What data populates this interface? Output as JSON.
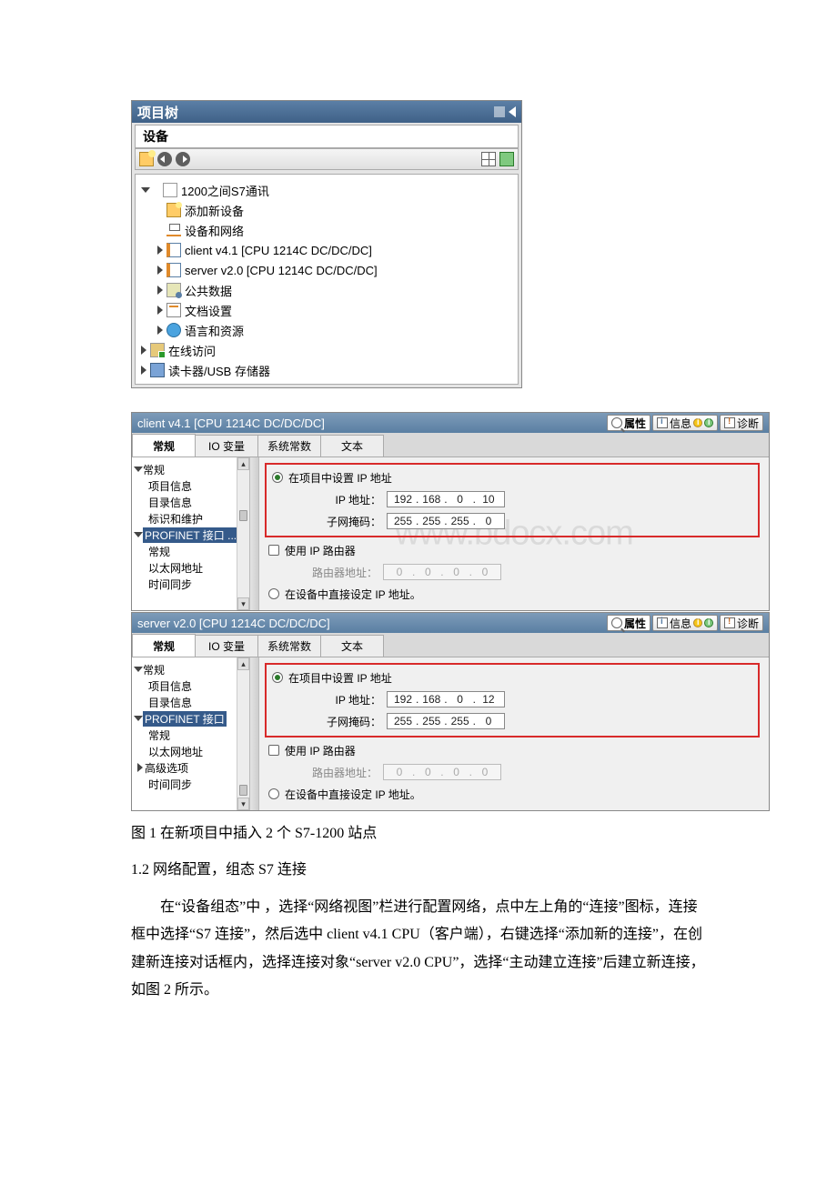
{
  "watermark": "www.bdocx.com",
  "projectTree": {
    "title": "项目树",
    "subtitle": "设备",
    "root": "1200之间S7通讯",
    "items": {
      "addDevice": "添加新设备",
      "devNet": "设备和网络",
      "client": "client v4.1 [CPU 1214C DC/DC/DC]",
      "server": "server v2.0 [CPU 1214C DC/DC/DC]",
      "common": "公共数据",
      "docset": "文档设置",
      "lang": "语言和资源",
      "online": "在线访问",
      "reader": "读卡器/USB 存储器"
    }
  },
  "tabs": {
    "general": "常规",
    "iovar": "IO 变量",
    "sysconst": "系统常数",
    "text": "文本"
  },
  "titleBtns": {
    "prop": "属性",
    "info": "信息",
    "diag": "诊断"
  },
  "nav": {
    "general": "常规",
    "projInfo": "项目信息",
    "dirInfo": "目录信息",
    "idMaint": "标识和维护",
    "profinet": "PROFINET 接口 ...",
    "profinet2": "PROFINET 接口",
    "ethAddr": "以太网地址",
    "timeSync": "时间同步",
    "advOpt": "高级选项"
  },
  "labels": {
    "setInProject": "在项目中设置 IP 地址",
    "ipAddr": "IP 地址：",
    "subnet": "子网掩码：",
    "useRouter": "使用 IP 路由器",
    "routerAddr": "路由器地址：",
    "setInDevice": "在设备中直接设定 IP 地址。"
  },
  "ipClient": {
    "a": "192",
    "b": "168",
    "c": "0",
    "d": "10"
  },
  "maskClient": {
    "a": "255",
    "b": "255",
    "c": "255",
    "d": "0"
  },
  "ipServer": {
    "a": "192",
    "b": "168",
    "c": "0",
    "d": "12"
  },
  "maskServer": {
    "a": "255",
    "b": "255",
    "c": "255",
    "d": "0"
  },
  "routerZero": {
    "a": "0",
    "b": "0",
    "c": "0",
    "d": "0"
  },
  "panel1Title": "client v4.1 [CPU 1214C DC/DC/DC]",
  "panel2Title": "server v2.0 [CPU 1214C DC/DC/DC]",
  "doc": {
    "caption": "图 1 在新项目中插入 2 个 S7-1200 站点",
    "heading": "1.2 网络配置，组态 S7 连接",
    "para": "在“设备组态”中 ，选择“网络视图”栏进行配置网络，点中左上角的“连接”图标，连接框中选择“S7 连接”，然后选中 client v4.1 CPU（客户端），右键选择“添加新的连接”，在创建新连接对话框内，选择连接对象“server v2.0 CPU”，选择“主动建立连接”后建立新连接，如图 2 所示。"
  }
}
